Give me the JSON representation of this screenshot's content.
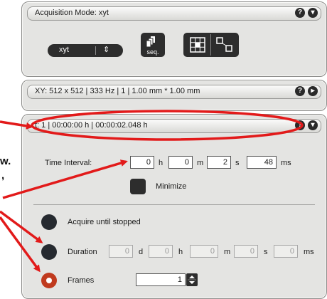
{
  "acquisition_panel": {
    "title": "Acquisition Mode: xyt",
    "mode_select": {
      "value": "xyt",
      "arrows": "⇕"
    },
    "seq_button_label": "seq."
  },
  "xy_panel": {
    "title": "XY:  512 x 512 | 333 Hz | 1 | 1.00 mm * 1.00 mm"
  },
  "time_panel": {
    "title": "t:    1  |   00:00:00 h  |   00:00:02.048 h",
    "interval": {
      "label": "Time Interval:",
      "hours": "0",
      "minutes": "0",
      "seconds": "2",
      "milliseconds": "48",
      "units": {
        "h": "h",
        "m": "m",
        "s": "s",
        "ms": "ms"
      }
    },
    "minimize_label": "Minimize",
    "options": {
      "acquire_until_stopped": "Acquire until stopped",
      "duration": {
        "label": "Duration",
        "days": "0",
        "hours": "0",
        "minutes": "0",
        "seconds": "0",
        "milliseconds": "0",
        "units": {
          "d": "d",
          "h": "h",
          "m": "m",
          "s": "s",
          "ms": "ms"
        }
      },
      "frames": {
        "label": "Frames",
        "value": "1"
      },
      "selected": "frames"
    }
  },
  "left_fragments": [
    "w.",
    ","
  ],
  "colors": {
    "annotation": "#e21a1a",
    "panel": "#e4e4e2",
    "selected_radio": "#c03a1e"
  }
}
